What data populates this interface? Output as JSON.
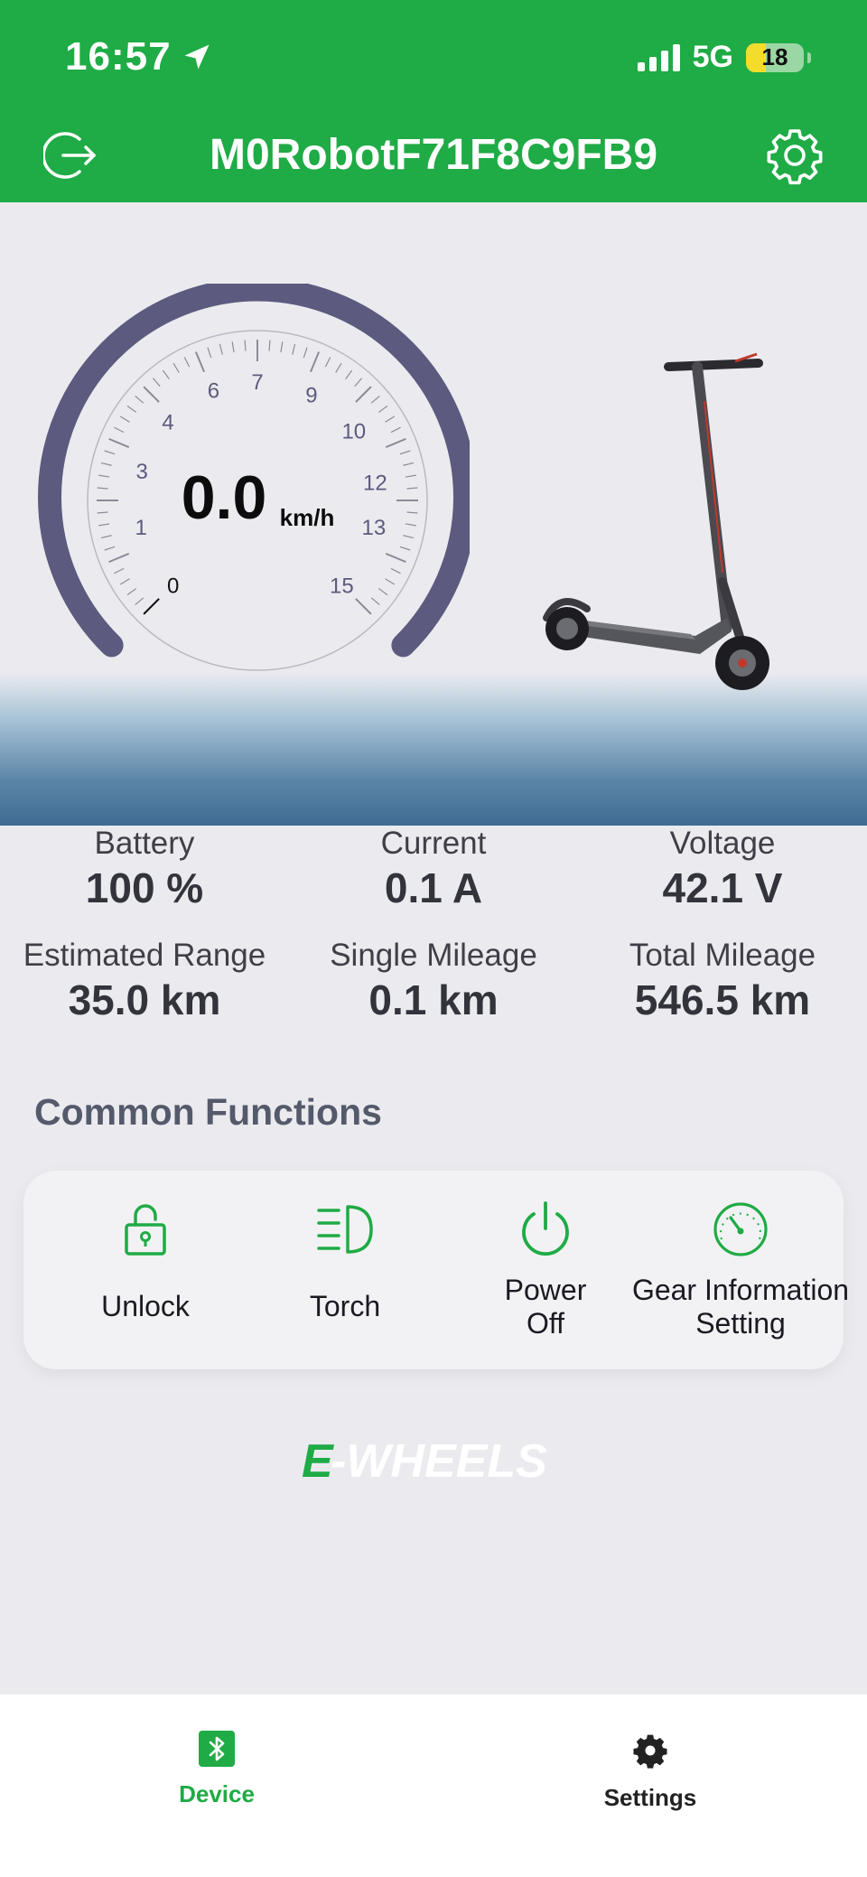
{
  "status_bar": {
    "time": "16:57",
    "network": "5G",
    "battery_level": "18"
  },
  "header": {
    "title": "M0RobotF71F8C9FB9"
  },
  "speedometer": {
    "speed": "0.0",
    "unit": "km/h",
    "ticks": [
      "0",
      "1",
      "3",
      "4",
      "6",
      "7",
      "9",
      "10",
      "12",
      "13",
      "15"
    ]
  },
  "stats": [
    {
      "label": "Battery",
      "value": "100 %"
    },
    {
      "label": "Current",
      "value": "0.1 A"
    },
    {
      "label": "Voltage",
      "value": "42.1 V"
    },
    {
      "label": "Estimated Range",
      "value": "35.0 km"
    },
    {
      "label": "Single Mileage",
      "value": "0.1 km"
    },
    {
      "label": "Total Mileage",
      "value": "546.5 km"
    }
  ],
  "common_functions": {
    "title": "Common Functions",
    "items": [
      {
        "label": "Unlock",
        "icon": "unlock-icon"
      },
      {
        "label": "Torch",
        "icon": "headlight-icon"
      },
      {
        "label": "Power Off",
        "icon": "power-icon"
      },
      {
        "label": "Gear Information Setting",
        "icon": "speedometer-icon"
      }
    ]
  },
  "brand": {
    "text_a": "E",
    "text_b": "-WHEELS"
  },
  "tabbar": {
    "tabs": [
      {
        "label": "Device",
        "icon": "bluetooth-icon",
        "active": true
      },
      {
        "label": "Settings",
        "icon": "gear-icon",
        "active": false
      }
    ]
  },
  "colors": {
    "primary": "#1fab45",
    "gauge_arc": "#5c5a7e",
    "tab_active": "#1fab45",
    "tab_inactive": "#222222"
  }
}
